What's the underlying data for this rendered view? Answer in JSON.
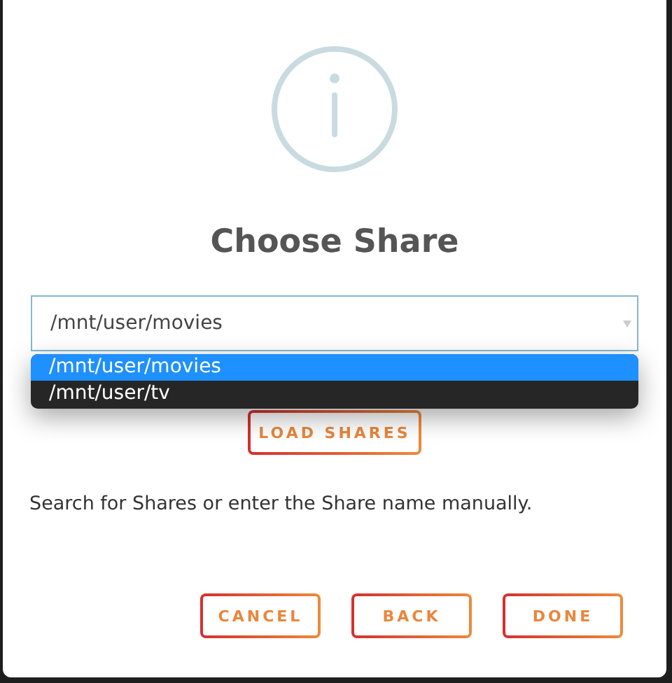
{
  "dialog": {
    "title": "Choose Share",
    "share_field": {
      "value": "/mnt/user/movies",
      "expanded": true
    },
    "options": [
      {
        "label": "/mnt/user/movies",
        "selected": true
      },
      {
        "label": "/mnt/user/tv",
        "selected": false
      }
    ],
    "load_button": "LOAD SHARES",
    "help_text": "Search for Shares or enter the Share name manually.",
    "buttons": [
      "CANCEL",
      "BACK",
      "DONE"
    ]
  }
}
